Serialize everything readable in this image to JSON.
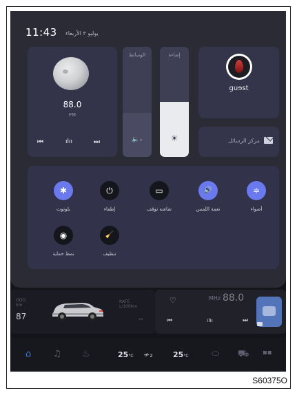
{
  "status": {
    "time": "11:43",
    "date": "يوليو ٣  الأربعاء"
  },
  "media_card": {
    "frequency": "88.0",
    "band": "FM",
    "prev": "⏮",
    "wave": "ılıı",
    "next": "⏭"
  },
  "sliders": {
    "media_label": "الوسائط",
    "media_icon": "🔈ₓ",
    "media_level": 0.4,
    "light_label": "إضاءة",
    "light_icon": "☀",
    "light_level": 0.5
  },
  "user": {
    "name": "guɘst"
  },
  "messages": {
    "label": "مركز الرسائل"
  },
  "tiles": [
    {
      "label": "بلوتوث",
      "icon": "✱",
      "style": "blue"
    },
    {
      "label": "إطفاء",
      "icon": "⏻",
      "style": "dark"
    },
    {
      "label": "شاشة توقف",
      "icon": "▭",
      "style": "dark"
    },
    {
      "label": "نغمة اللمس",
      "icon": "🔊",
      "style": "blue"
    },
    {
      "label": "أضواء",
      "icon": "≑",
      "style": "blue"
    },
    {
      "label": "نمط حماية",
      "icon": "◉",
      "style": "dark"
    },
    {
      "label": "تنظيف",
      "icon": "🧹",
      "style": "dark"
    }
  ],
  "odometer": {
    "label": "ODO\nkm",
    "value": "87",
    "rafe_label": "RAFE\nL/100km",
    "rafe_value": "--"
  },
  "radio": {
    "heart": "♡",
    "unit": "MHz",
    "frequency": "88.0",
    "prev": "⏮",
    "wave": "ılıı",
    "next": "⏭"
  },
  "dock": {
    "home": "⌂",
    "music": "♫",
    "defrost": "♨",
    "temp_left": "25",
    "temp_unit": "°C",
    "fan": "≁₂",
    "temp_right": "25",
    "car_view": "⬭",
    "car": "⛟",
    "apps": "▪▪"
  },
  "figure_code": "S60375O"
}
